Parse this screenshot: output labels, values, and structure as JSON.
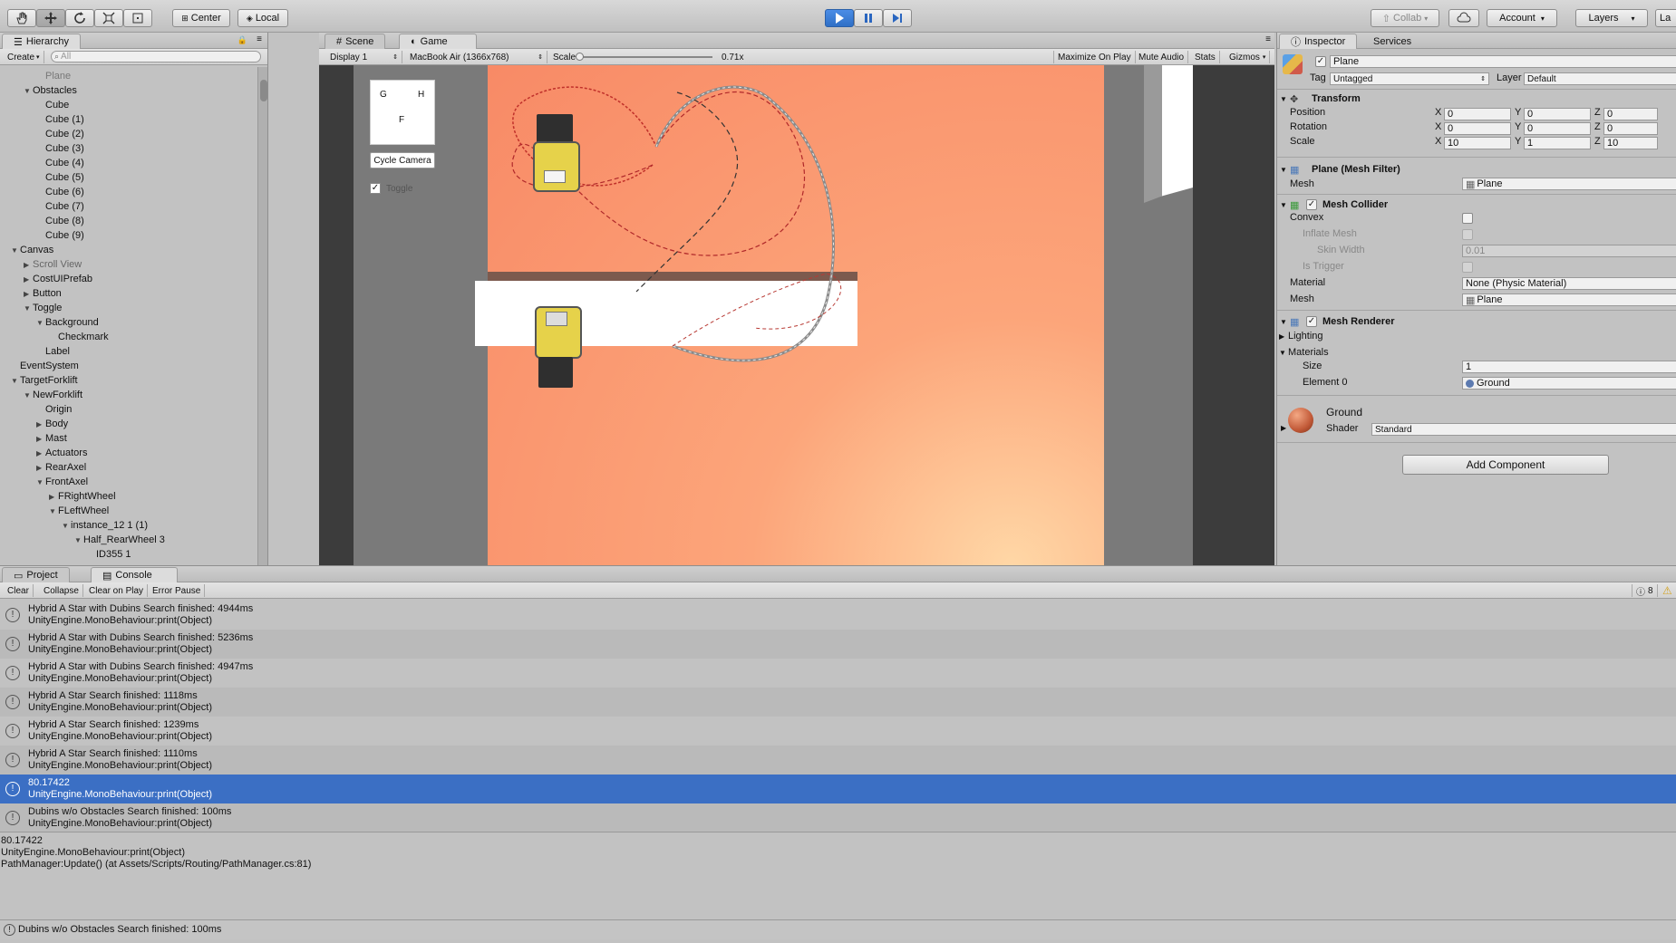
{
  "toolbar": {
    "pivot_label": "Center",
    "space_label": "Local",
    "collab_label": "Collab",
    "account_label": "Account",
    "layers_label": "Layers",
    "layout_label": "La"
  },
  "hierarchy": {
    "tab_label": "Hierarchy",
    "create_label": "Create",
    "search_placeholder": "All",
    "items": [
      {
        "label": "Plane",
        "depth": 3,
        "arrow": ""
      },
      {
        "label": "Obstacles",
        "depth": 2,
        "arrow": "▼"
      },
      {
        "label": "Cube",
        "depth": 3,
        "arrow": ""
      },
      {
        "label": "Cube (1)",
        "depth": 3,
        "arrow": ""
      },
      {
        "label": "Cube (2)",
        "depth": 3,
        "arrow": ""
      },
      {
        "label": "Cube (3)",
        "depth": 3,
        "arrow": ""
      },
      {
        "label": "Cube (4)",
        "depth": 3,
        "arrow": ""
      },
      {
        "label": "Cube (5)",
        "depth": 3,
        "arrow": ""
      },
      {
        "label": "Cube (6)",
        "depth": 3,
        "arrow": ""
      },
      {
        "label": "Cube (7)",
        "depth": 3,
        "arrow": ""
      },
      {
        "label": "Cube (8)",
        "depth": 3,
        "arrow": ""
      },
      {
        "label": "Cube (9)",
        "depth": 3,
        "arrow": ""
      },
      {
        "label": "Canvas",
        "depth": 1,
        "arrow": "▼"
      },
      {
        "label": "Scroll View",
        "depth": 2,
        "arrow": "▶"
      },
      {
        "label": "CostUIPrefab",
        "depth": 2,
        "arrow": "▶"
      },
      {
        "label": "Button",
        "depth": 2,
        "arrow": "▶"
      },
      {
        "label": "Toggle",
        "depth": 2,
        "arrow": "▼"
      },
      {
        "label": "Background",
        "depth": 3,
        "arrow": "▼"
      },
      {
        "label": "Checkmark",
        "depth": 4,
        "arrow": ""
      },
      {
        "label": "Label",
        "depth": 3,
        "arrow": ""
      },
      {
        "label": "EventSystem",
        "depth": 1,
        "arrow": ""
      },
      {
        "label": "TargetForklift",
        "depth": 1,
        "arrow": "▼"
      },
      {
        "label": "NewForklift",
        "depth": 2,
        "arrow": "▼"
      },
      {
        "label": "Origin",
        "depth": 3,
        "arrow": ""
      },
      {
        "label": "Body",
        "depth": 3,
        "arrow": "▶"
      },
      {
        "label": "Mast",
        "depth": 3,
        "arrow": "▶"
      },
      {
        "label": "Actuators",
        "depth": 3,
        "arrow": "▶"
      },
      {
        "label": "RearAxel",
        "depth": 3,
        "arrow": "▶"
      },
      {
        "label": "FrontAxel",
        "depth": 3,
        "arrow": "▼"
      },
      {
        "label": "FRightWheel",
        "depth": 4,
        "arrow": "▶"
      },
      {
        "label": "FLeftWheel",
        "depth": 4,
        "arrow": "▼"
      },
      {
        "label": "instance_12 1 (1)",
        "depth": 5,
        "arrow": "▼"
      },
      {
        "label": "Half_RearWheel 3",
        "depth": 6,
        "arrow": "▼"
      },
      {
        "label": "ID355 1",
        "depth": 7,
        "arrow": ""
      }
    ]
  },
  "game": {
    "scene_tab": "Scene",
    "game_tab": "Game",
    "display": "Display 1",
    "resolution": "MacBook Air (1366x768)",
    "scale_label": "Scale",
    "scale_value": "0.71x",
    "maximize": "Maximize On Play",
    "mute": "Mute Audio",
    "stats": "Stats",
    "gizmos": "Gizmos",
    "overlay_keys": [
      "G",
      "H",
      "F"
    ],
    "cycle_camera": "Cycle Camera",
    "toggle_label": "Toggle"
  },
  "inspector": {
    "tab_label": "Inspector",
    "services_tab": "Services",
    "object_name": "Plane",
    "tag_label": "Tag",
    "tag_value": "Untagged",
    "layer_label": "Layer",
    "layer_value": "Default",
    "transform_title": "Transform",
    "position_label": "Position",
    "rotation_label": "Rotation",
    "scale_label": "Scale",
    "position": {
      "x": "0",
      "y": "0",
      "z": "0"
    },
    "rotation": {
      "x": "0",
      "y": "0",
      "z": "0"
    },
    "scale": {
      "x": "10",
      "y": "1",
      "z": "10"
    },
    "axis_x": "X",
    "axis_y": "Y",
    "axis_z": "Z",
    "mesh_filter_title": "Plane (Mesh Filter)",
    "mesh_label": "Mesh",
    "mesh_value": "Plane",
    "collider_title": "Mesh Collider",
    "convex_label": "Convex",
    "inflate_label": "Inflate Mesh",
    "skin_label": "Skin Width",
    "skin_value": "0.01",
    "trigger_label": "Is Trigger",
    "material_label": "Material",
    "material_value": "None (Physic Material)",
    "collider_mesh_label": "Mesh",
    "collider_mesh_value": "Plane",
    "renderer_title": "Mesh Renderer",
    "lighting_label": "Lighting",
    "materials_label": "Materials",
    "size_label": "Size",
    "size_value": "1",
    "element_label": "Element 0",
    "element_value": "Ground",
    "material_name": "Ground",
    "shader_label": "Shader",
    "shader_value": "Standard",
    "add_component": "Add Component"
  },
  "console": {
    "project_tab": "Project",
    "console_tab": "Console",
    "buttons": [
      "Clear",
      "Collapse",
      "Clear on Play",
      "Error Pause"
    ],
    "count": "8",
    "entries": [
      {
        "l1": "Hybrid A Star with Dubins Search finished: 4944ms",
        "l2": "UnityEngine.MonoBehaviour:print(Object)"
      },
      {
        "l1": "Hybrid A Star with Dubins Search finished: 5236ms",
        "l2": "UnityEngine.MonoBehaviour:print(Object)"
      },
      {
        "l1": "Hybrid A Star with Dubins Search finished: 4947ms",
        "l2": "UnityEngine.MonoBehaviour:print(Object)"
      },
      {
        "l1": "Hybrid A Star Search finished: 1118ms",
        "l2": "UnityEngine.MonoBehaviour:print(Object)"
      },
      {
        "l1": "Hybrid A Star Search finished: 1239ms",
        "l2": "UnityEngine.MonoBehaviour:print(Object)"
      },
      {
        "l1": "Hybrid A Star Search finished: 1110ms",
        "l2": "UnityEngine.MonoBehaviour:print(Object)"
      },
      {
        "l1": "80.17422",
        "l2": "UnityEngine.MonoBehaviour:print(Object)"
      },
      {
        "l1": "Dubins w/o Obstacles Search finished: 100ms",
        "l2": "UnityEngine.MonoBehaviour:print(Object)"
      }
    ],
    "detail": [
      "80.17422",
      "UnityEngine.MonoBehaviour:print(Object)",
      "PathManager:Update() (at Assets/Scripts/Routing/PathManager.cs:81)"
    ],
    "status": "Dubins w/o Obstacles Search finished: 100ms"
  },
  "colors": {
    "selection": "#3b6fc4",
    "ground_orange": "#f99a6e",
    "play_blue": "#3a7fd8"
  }
}
